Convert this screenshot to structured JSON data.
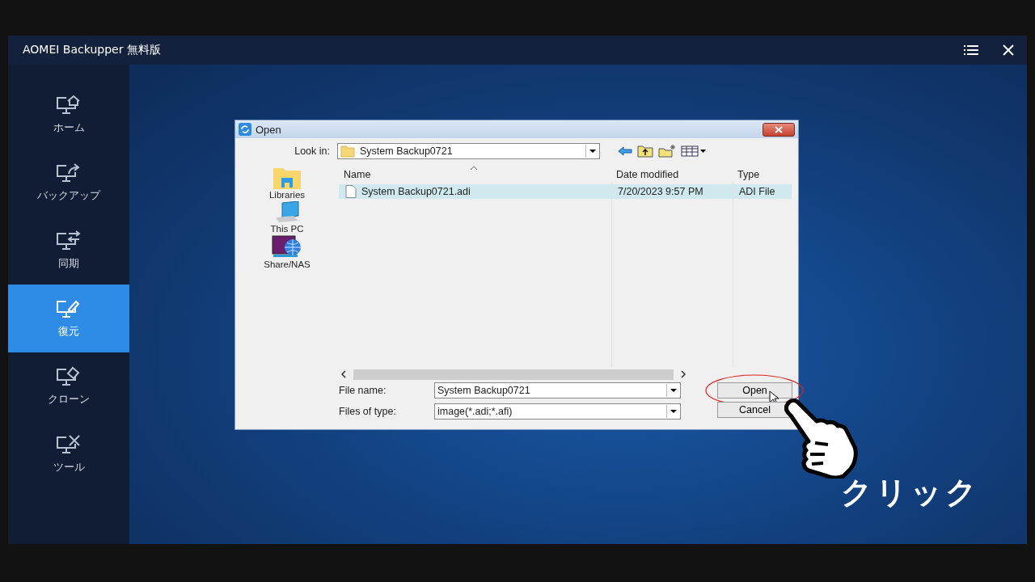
{
  "app": {
    "title": "AOMEI Backupper 無料版"
  },
  "sidebar": {
    "items": [
      {
        "label": "ホーム",
        "kind": "home",
        "selected": false
      },
      {
        "label": "バックアップ",
        "kind": "backup",
        "selected": false
      },
      {
        "label": "同期",
        "kind": "sync",
        "selected": false
      },
      {
        "label": "復元",
        "kind": "restore",
        "selected": true
      },
      {
        "label": "クローン",
        "kind": "clone",
        "selected": false
      },
      {
        "label": "ツール",
        "kind": "tools",
        "selected": false
      }
    ]
  },
  "dialog": {
    "title": "Open",
    "look_in": {
      "label": "Look in:",
      "value": "System Backup0721"
    },
    "places": [
      {
        "label": "Libraries",
        "kind": "libraries"
      },
      {
        "label": "This PC",
        "kind": "pc"
      },
      {
        "label": "Share/NAS",
        "kind": "nas"
      }
    ],
    "columns": [
      "Name",
      "Date modified",
      "Type"
    ],
    "rows": [
      {
        "name": "System Backup0721.adi",
        "date": "7/20/2023 9:57 PM",
        "type": "ADI File",
        "selected": true
      }
    ],
    "file_name": {
      "label": "File name:",
      "value": "System Backup0721"
    },
    "file_type": {
      "label": "Files of type:",
      "value": "image(*.adi;*.afi)"
    },
    "buttons": [
      {
        "label": "Open",
        "highlighted": true
      },
      {
        "label": "Cancel",
        "highlighted": false
      }
    ]
  },
  "annotation": {
    "text": "クリック"
  }
}
